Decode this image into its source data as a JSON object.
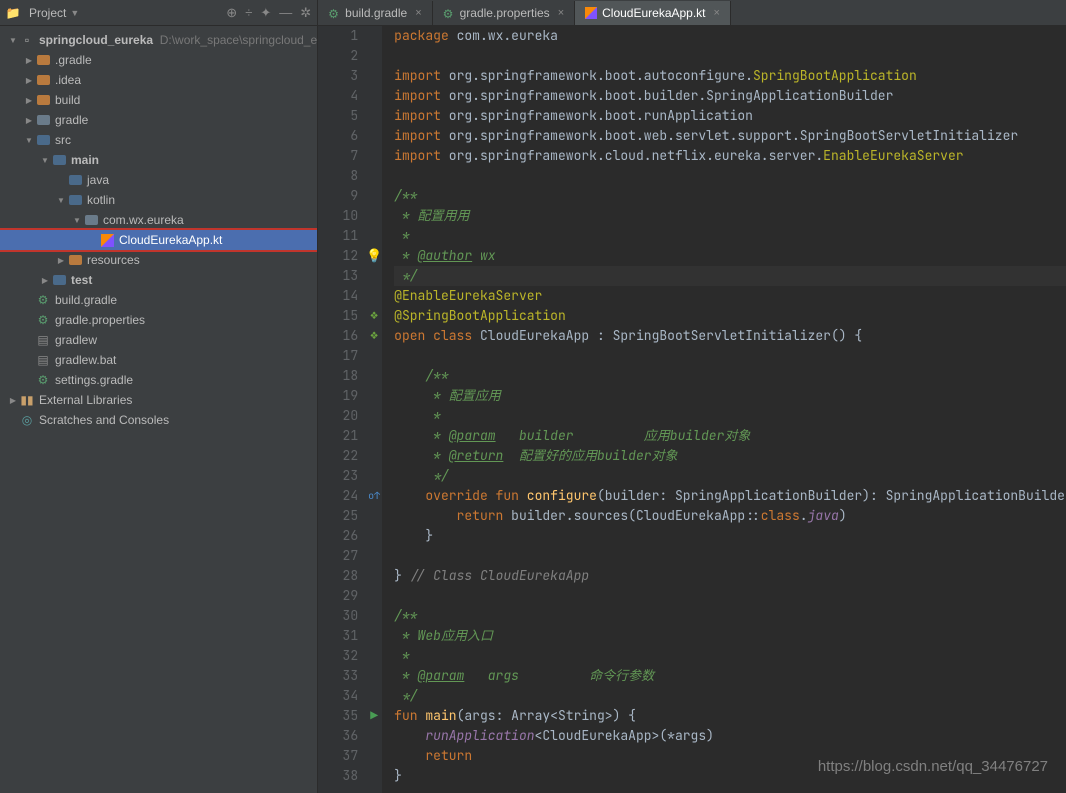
{
  "header": {
    "project_label": "Project",
    "arrow": "▼"
  },
  "header_icons": [
    "⊕",
    "÷",
    "✦",
    "—",
    "✲"
  ],
  "tree": {
    "root": {
      "name": "springcloud_eureka",
      "path": "D:\\work_space\\springcloud_e"
    },
    "nodes": [
      {
        "indent": 1,
        "chev": "closed",
        "icon": "orange",
        "label": ".gradle"
      },
      {
        "indent": 1,
        "chev": "closed",
        "icon": "orange",
        "label": ".idea"
      },
      {
        "indent": 1,
        "chev": "closed",
        "icon": "orange",
        "label": "build"
      },
      {
        "indent": 1,
        "chev": "closed",
        "icon": "grey",
        "label": "gradle"
      },
      {
        "indent": 1,
        "chev": "open",
        "icon": "blue",
        "label": "src"
      },
      {
        "indent": 2,
        "chev": "open",
        "icon": "blue",
        "label": "main",
        "bold": true
      },
      {
        "indent": 3,
        "chev": "none",
        "icon": "blue",
        "label": "java"
      },
      {
        "indent": 3,
        "chev": "open",
        "icon": "blue",
        "label": "kotlin"
      },
      {
        "indent": 4,
        "chev": "open",
        "icon": "grey",
        "label": "com.wx.eureka"
      },
      {
        "indent": 5,
        "chev": "none",
        "icon": "kt",
        "label": "CloudEurekaApp.kt",
        "sel": true,
        "hl": true
      },
      {
        "indent": 3,
        "chev": "closed",
        "icon": "orange",
        "label": "resources"
      },
      {
        "indent": 2,
        "chev": "closed",
        "icon": "blue",
        "label": "test",
        "bold": true
      },
      {
        "indent": 1,
        "chev": "none",
        "icon": "gradle",
        "label": "build.gradle"
      },
      {
        "indent": 1,
        "chev": "none",
        "icon": "gradle",
        "label": "gradle.properties"
      },
      {
        "indent": 1,
        "chev": "none",
        "icon": "file",
        "label": "gradlew"
      },
      {
        "indent": 1,
        "chev": "none",
        "icon": "file",
        "label": "gradlew.bat"
      },
      {
        "indent": 1,
        "chev": "none",
        "icon": "gradle",
        "label": "settings.gradle"
      },
      {
        "indent": 0,
        "chev": "closed",
        "icon": "lib",
        "label": "External Libraries"
      },
      {
        "indent": 0,
        "chev": "none",
        "icon": "scratch",
        "label": "Scratches and Consoles"
      }
    ]
  },
  "tabs": [
    {
      "label": "build.gradle",
      "icon": "gradle",
      "active": false
    },
    {
      "label": "gradle.properties",
      "icon": "gradle",
      "active": false
    },
    {
      "label": "CloudEurekaApp.kt",
      "icon": "kt",
      "active": true
    }
  ],
  "gutter_icons": {
    "12": "💡",
    "15": "🌿",
    "16": "🌿",
    "24": "⬆",
    "35": "▶"
  },
  "code_lines": [
    {
      "n": 1,
      "h": "<span class='kw'>package</span> <span class='plain'>com.wx.eureka</span>"
    },
    {
      "n": 2,
      "h": ""
    },
    {
      "n": 3,
      "h": "<span class='kw'>import</span> <span class='plain'>org.springframework.boot.autoconfigure.</span><span class='ann'>SpringBootApplication</span>"
    },
    {
      "n": 4,
      "h": "<span class='kw'>import</span> <span class='plain'>org.springframework.boot.builder.SpringApplicationBuilder</span>"
    },
    {
      "n": 5,
      "h": "<span class='kw'>import</span> <span class='plain'>org.springframework.boot.runApplication</span>"
    },
    {
      "n": 6,
      "h": "<span class='kw'>import</span> <span class='plain'>org.springframework.boot.web.servlet.support.SpringBootServletInitializer</span>"
    },
    {
      "n": 7,
      "h": "<span class='kw'>import</span> <span class='plain'>org.springframework.cloud.netflix.eureka.server.</span><span class='ann'>EnableEurekaServer</span>"
    },
    {
      "n": 8,
      "h": ""
    },
    {
      "n": 9,
      "h": "<span class='commentdoc'>/**</span>"
    },
    {
      "n": 10,
      "h": "<span class='commentdoc'> * 配置用用</span>"
    },
    {
      "n": 11,
      "h": "<span class='commentdoc'> *</span>"
    },
    {
      "n": 12,
      "h": "<span class='commentdoc'> * </span><span class='doctag'>@author</span><span class='commentdoc'> wx</span>"
    },
    {
      "n": 13,
      "h": "<span class='commentdoc'> */</span>",
      "caret": true
    },
    {
      "n": 14,
      "h": "<span class='ann'>@EnableEurekaServer</span>"
    },
    {
      "n": 15,
      "h": "<span class='ann'>@SpringBootApplication</span>"
    },
    {
      "n": 16,
      "h": "<span class='kw'>open class</span> <span class='plain'>CloudEurekaApp : SpringBootServletInitializer() {</span>"
    },
    {
      "n": 17,
      "h": ""
    },
    {
      "n": 18,
      "h": "    <span class='commentdoc'>/**</span>"
    },
    {
      "n": 19,
      "h": "    <span class='commentdoc'> * 配置应用</span>"
    },
    {
      "n": 20,
      "h": "    <span class='commentdoc'> *</span>"
    },
    {
      "n": 21,
      "h": "    <span class='commentdoc'> * </span><span class='doctag'>@param</span><span class='commentdoc'>   builder         应用builder对象</span>"
    },
    {
      "n": 22,
      "h": "    <span class='commentdoc'> * </span><span class='doctag'>@return</span><span class='commentdoc'>  配置好的应用builder对象</span>"
    },
    {
      "n": 23,
      "h": "    <span class='commentdoc'> */</span>"
    },
    {
      "n": 24,
      "h": "    <span class='kw'>override fun</span> <span class='fn'>configure</span><span class='plain'>(builder: SpringApplicationBuilder): SpringApplicationBuilder {</span>"
    },
    {
      "n": 25,
      "h": "        <span class='kw'>return</span> <span class='plain'>builder.sources(CloudEurekaApp::</span><span class='kw'>class</span><span class='plain'>.</span><span class='ital'>java</span><span class='plain'>)</span>"
    },
    {
      "n": 26,
      "h": "    <span class='plain'>}</span>"
    },
    {
      "n": 27,
      "h": ""
    },
    {
      "n": 28,
      "h": "<span class='plain'>}</span> <span class='comment'>// Class CloudEurekaApp</span>"
    },
    {
      "n": 29,
      "h": ""
    },
    {
      "n": 30,
      "h": "<span class='commentdoc'>/**</span>"
    },
    {
      "n": 31,
      "h": "<span class='commentdoc'> * Web应用入口</span>"
    },
    {
      "n": 32,
      "h": "<span class='commentdoc'> *</span>"
    },
    {
      "n": 33,
      "h": "<span class='commentdoc'> * </span><span class='doctag'>@param</span><span class='commentdoc'>   args         命令行参数</span>"
    },
    {
      "n": 34,
      "h": "<span class='commentdoc'> */</span>"
    },
    {
      "n": 35,
      "h": "<span class='kw'>fun</span> <span class='fn'>main</span><span class='plain'>(args: Array&lt;String&gt;) {</span>"
    },
    {
      "n": 36,
      "h": "    <span class='ital'>runApplication</span><span class='plain'>&lt;CloudEurekaApp&gt;(*args)</span>"
    },
    {
      "n": 37,
      "h": "    <span class='kw'>return</span>"
    },
    {
      "n": 38,
      "h": "<span class='plain'>}</span>"
    }
  ],
  "watermark": "https://blog.csdn.net/qq_34476727"
}
